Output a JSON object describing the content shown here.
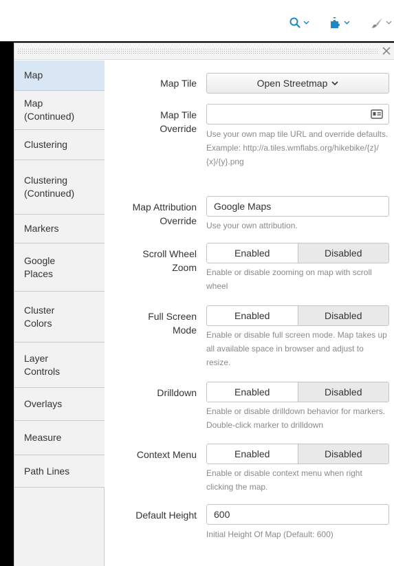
{
  "toolbar": {
    "items": [
      {
        "icon": "search-icon"
      },
      {
        "icon": "puzzle-icon"
      },
      {
        "icon": "paintbrush-icon"
      }
    ]
  },
  "panel": {
    "close_icon": "close-icon",
    "sidebar": [
      {
        "label": "Map",
        "active": true
      },
      {
        "label": "Map\n(Continued)"
      },
      {
        "label": "Clustering"
      },
      {
        "label": "Clustering\n(Continued)"
      },
      {
        "label": "Markers"
      },
      {
        "label": "Google\nPlaces"
      },
      {
        "label": "Cluster\nColors"
      },
      {
        "label": "Layer\nControls"
      },
      {
        "label": "Overlays"
      },
      {
        "label": "Measure"
      },
      {
        "label": "Path Lines"
      }
    ],
    "fields": {
      "map_tile": {
        "label": "Map Tile",
        "value": "Open Streetmap"
      },
      "map_tile_override": {
        "label": "Map Tile\nOverride",
        "value": "",
        "help": "Use your own map tile URL and override defaults. Example: http://a.tiles.wmflabs.org/hikebike/{z}/{x}/{y}.png"
      },
      "map_attribution": {
        "label": "Map Attribution\nOverride",
        "value": "Google Maps",
        "help": "Use your own attribution."
      },
      "scroll_wheel": {
        "label": "Scroll Wheel\nZoom",
        "on": "Enabled",
        "off": "Disabled",
        "help": "Enable or disable zooming on map with scroll wheel"
      },
      "full_screen": {
        "label": "Full Screen\nMode",
        "on": "Enabled",
        "off": "Disabled",
        "help": "Enable or disable full screen mode. Map takes up all available space in browser and adjust to resize."
      },
      "drilldown": {
        "label": "Drilldown",
        "on": "Enabled",
        "off": "Disabled",
        "help": "Enable or disable drilldown behavior for markers. Double-click marker to drilldown"
      },
      "context_menu": {
        "label": "Context Menu",
        "on": "Enabled",
        "off": "Disabled",
        "help": "Enable or disable context menu when right clicking the map."
      },
      "default_height": {
        "label": "Default Height",
        "value": "600",
        "help": "Initial Height Of Map (Default: 600)"
      }
    }
  }
}
